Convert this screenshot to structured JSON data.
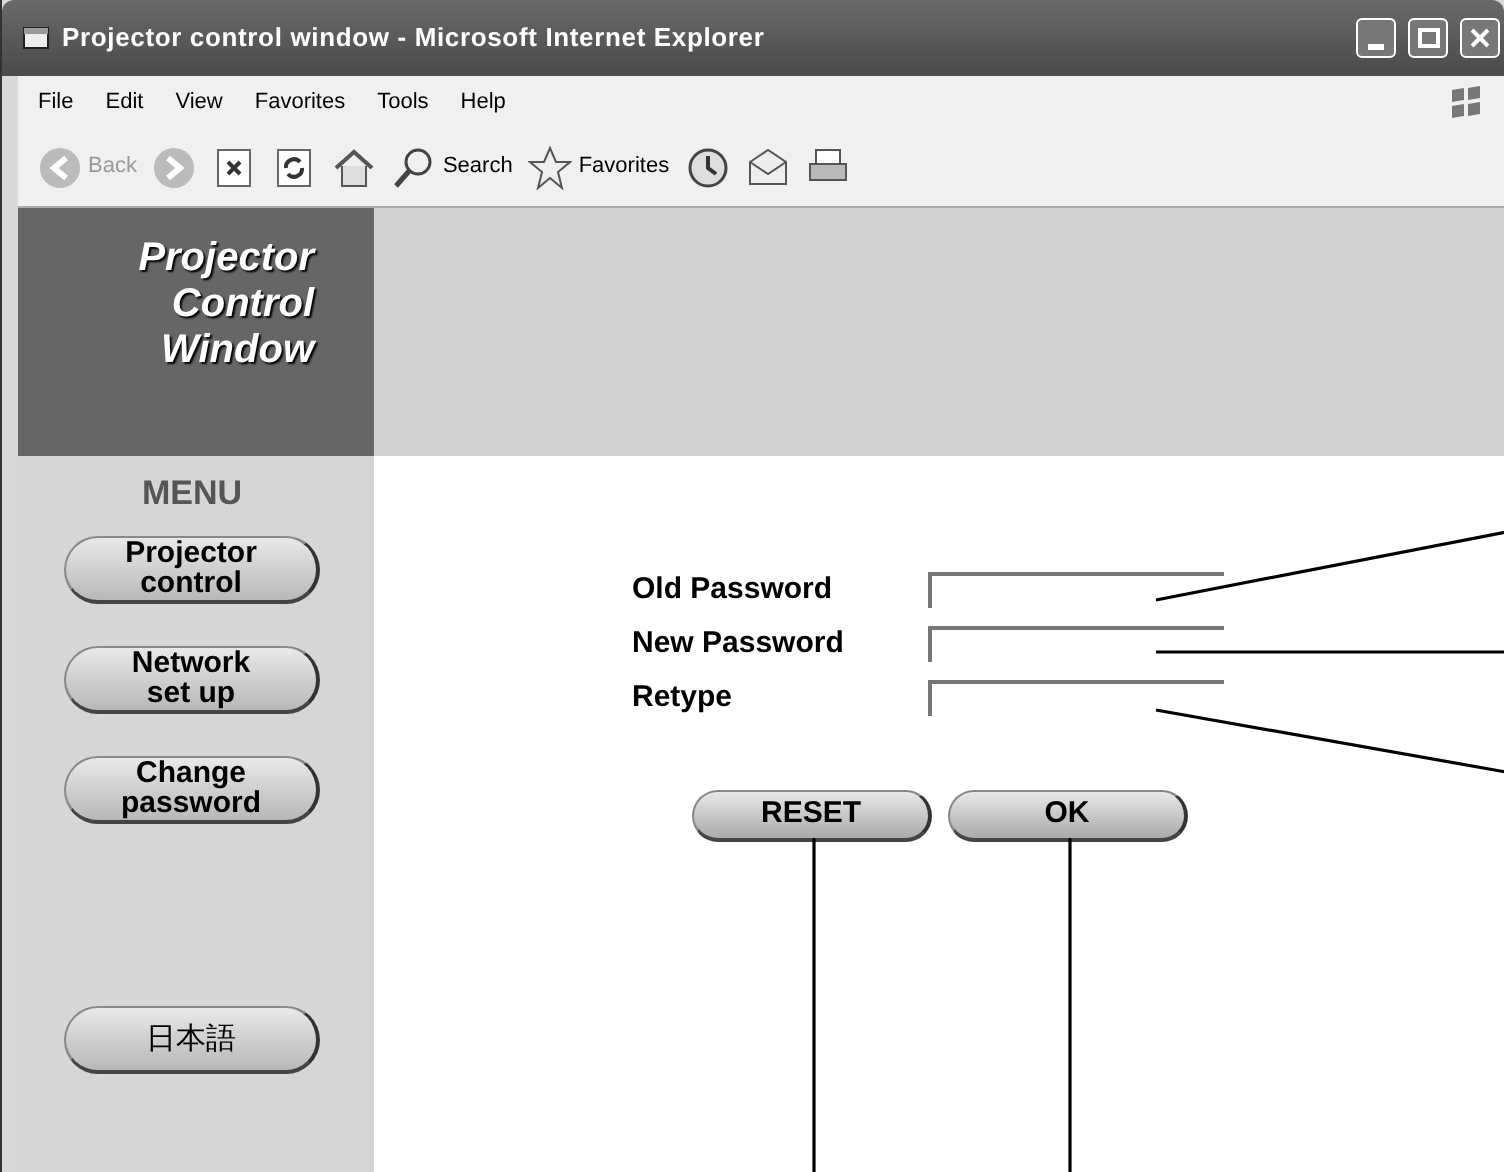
{
  "window": {
    "title": "Projector control window - Microsoft Internet Explorer"
  },
  "menu_bar": [
    "File",
    "Edit",
    "View",
    "Favorites",
    "Tools",
    "Help"
  ],
  "toolbar": [
    {
      "kind": "back",
      "label": "Back"
    },
    {
      "kind": "forward"
    },
    {
      "kind": "stop"
    },
    {
      "kind": "refresh"
    },
    {
      "kind": "home"
    },
    {
      "kind": "search",
      "label": "Search"
    },
    {
      "kind": "favorites",
      "label": "Favorites"
    },
    {
      "kind": "history"
    },
    {
      "kind": "mail"
    },
    {
      "kind": "print"
    }
  ],
  "header": {
    "logo": [
      "Projector",
      "Control",
      "Window"
    ]
  },
  "sidebar": {
    "heading": "MENU",
    "items": [
      {
        "label": "Projector\ncontrol"
      },
      {
        "label": "Network\nset up"
      },
      {
        "label": "Change\npassword"
      },
      {
        "label": "日本語"
      }
    ]
  },
  "form": {
    "fields": [
      {
        "label": "Old Password"
      },
      {
        "label": "New Password"
      },
      {
        "label": "Retype"
      }
    ],
    "buttons": [
      "RESET",
      "OK"
    ]
  }
}
